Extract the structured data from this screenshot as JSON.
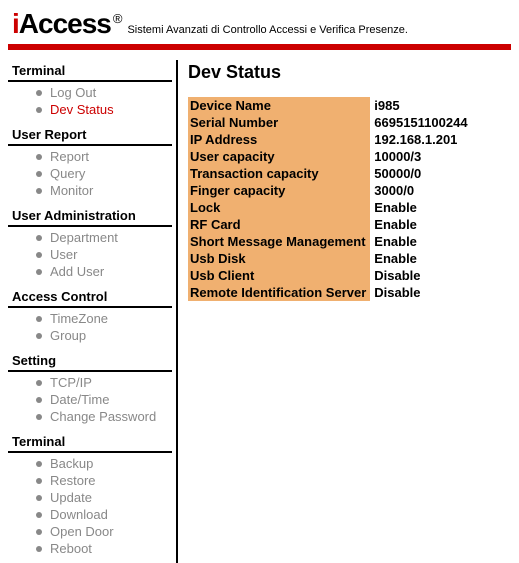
{
  "header": {
    "logo_i": "i",
    "logo_rest": "Access",
    "reg": "®",
    "tagline": "Sistemi Avanzati di Controllo Accessi e Verifica Presenze."
  },
  "sidebar": [
    {
      "title": "Terminal",
      "items": [
        {
          "label": "Log Out",
          "active": false
        },
        {
          "label": "Dev Status",
          "active": true
        }
      ]
    },
    {
      "title": "User Report",
      "items": [
        {
          "label": "Report",
          "active": false
        },
        {
          "label": "Query",
          "active": false
        },
        {
          "label": "Monitor",
          "active": false
        }
      ]
    },
    {
      "title": "User Administration",
      "items": [
        {
          "label": "Department",
          "active": false
        },
        {
          "label": "User",
          "active": false
        },
        {
          "label": "Add User",
          "active": false
        }
      ]
    },
    {
      "title": "Access Control",
      "items": [
        {
          "label": "TimeZone",
          "active": false
        },
        {
          "label": "Group",
          "active": false
        }
      ]
    },
    {
      "title": "Setting",
      "items": [
        {
          "label": "TCP/IP",
          "active": false
        },
        {
          "label": "Date/Time",
          "active": false
        },
        {
          "label": "Change Password",
          "active": false
        }
      ]
    },
    {
      "title": "Terminal",
      "items": [
        {
          "label": "Backup",
          "active": false
        },
        {
          "label": "Restore",
          "active": false
        },
        {
          "label": "Update",
          "active": false
        },
        {
          "label": "Download",
          "active": false
        },
        {
          "label": "Open Door",
          "active": false
        },
        {
          "label": "Reboot",
          "active": false
        }
      ]
    }
  ],
  "main": {
    "title": "Dev Status",
    "rows": [
      {
        "label": "Device Name",
        "value": "i985"
      },
      {
        "label": "Serial Number",
        "value": "6695151100244"
      },
      {
        "label": "IP Address",
        "value": "192.168.1.201"
      },
      {
        "label": "User capacity",
        "value": "10000/3"
      },
      {
        "label": "Transaction capacity",
        "value": "50000/0"
      },
      {
        "label": "Finger capacity",
        "value": "3000/0"
      },
      {
        "label": "Lock",
        "value": "Enable"
      },
      {
        "label": "RF Card",
        "value": "Enable"
      },
      {
        "label": "Short Message Management",
        "value": "Enable"
      },
      {
        "label": "Usb Disk",
        "value": "Enable"
      },
      {
        "label": "Usb Client",
        "value": "Disable"
      },
      {
        "label": "Remote Identification Server",
        "value": "Disable"
      }
    ]
  }
}
